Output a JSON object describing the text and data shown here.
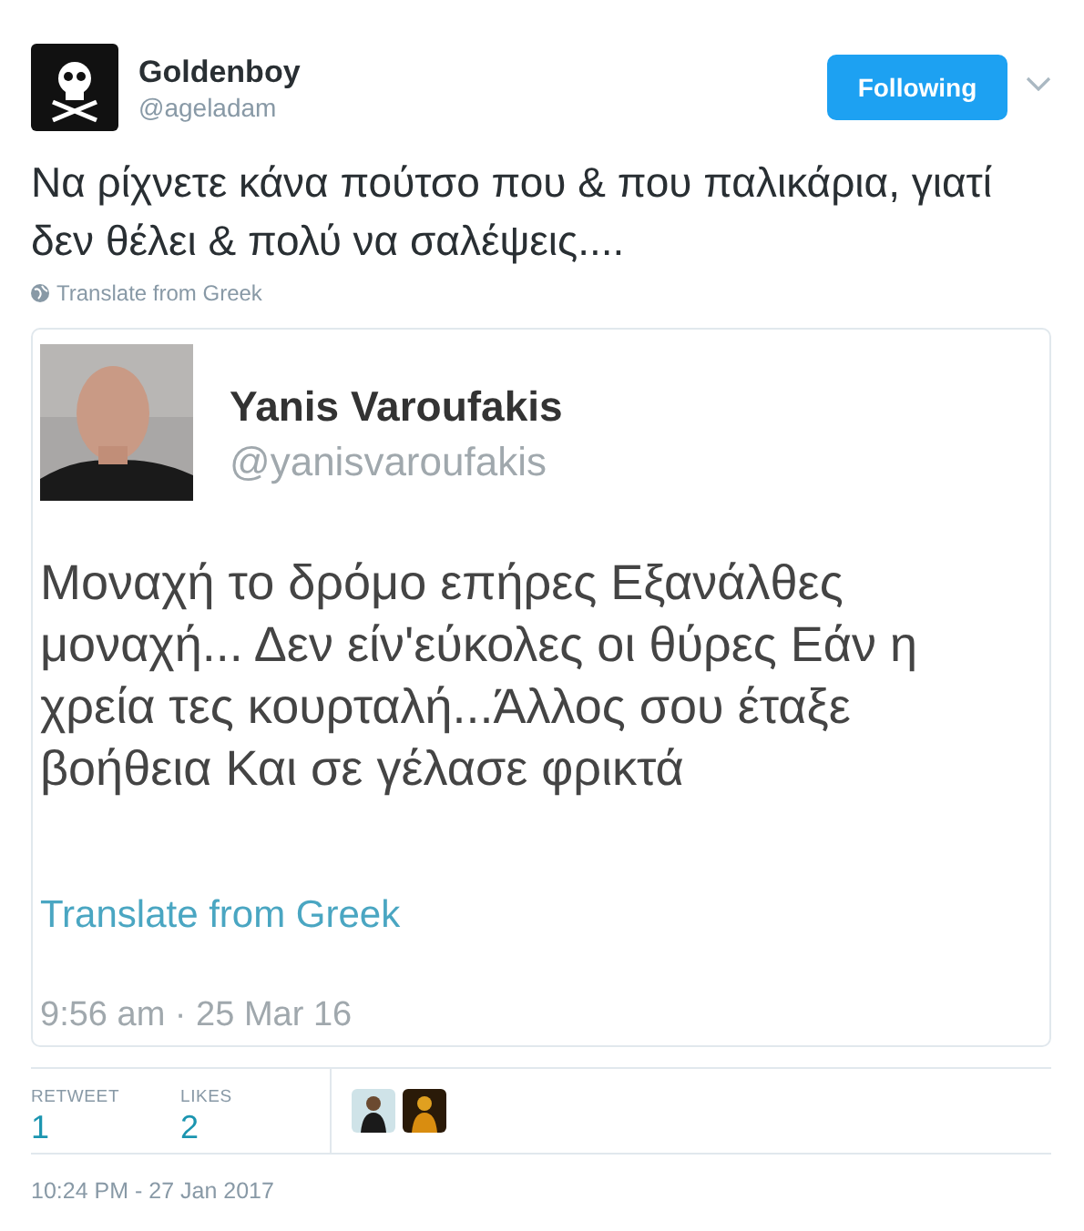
{
  "author": {
    "name": "Goldenboy",
    "handle": "@ageladam"
  },
  "follow_button": {
    "label": "Following",
    "following": true
  },
  "tweet": {
    "text": "Να ρίχνετε κάνα πούτσο που & που παλικάρια, γιατί δεν θέλει & πολύ να σαλέψεις....",
    "translate": "Translate from Greek"
  },
  "embedded_screenshot": {
    "name": "Yanis Varoufakis",
    "handle": "@yanisvaroufakis",
    "text": "Μοναχή το δρόμο επήρες Εξανάλθες μοναχή... Δεν είν'εύκολες οι θύρες Εάν η χρεία τες κουρταλή...Άλλος σου έταξε βοήθεια Και σε γέλασε φρικτά",
    "translate": "Translate from Greek",
    "time": "9:56 am · 25 Mar 16"
  },
  "stats": [
    {
      "label": "RETWEET",
      "count": "1"
    },
    {
      "label": "LIKES",
      "count": "2"
    }
  ],
  "timestamp": "10:24 PM - 27 Jan 2017"
}
